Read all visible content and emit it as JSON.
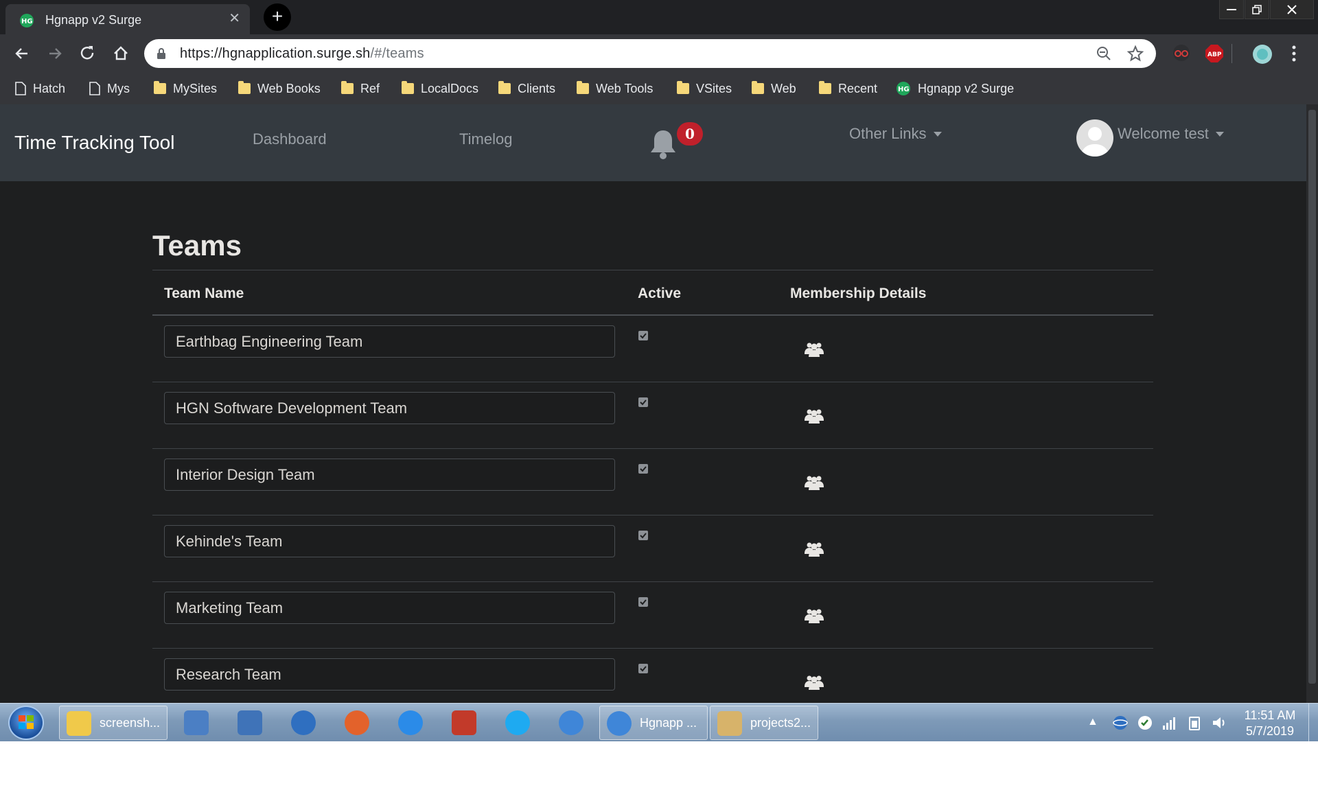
{
  "browser": {
    "tab_title": "Hgnapp v2 Surge",
    "tab_close": "✕",
    "new_tab": "+",
    "url_host": "https://hgnapplication.surge.sh",
    "url_path": "/#/teams",
    "ext_abp": "ABP",
    "bookmarks": [
      {
        "label": "Hatch",
        "icon": "page"
      },
      {
        "label": "Mys",
        "icon": "page"
      },
      {
        "label": "MySites",
        "icon": "folder"
      },
      {
        "label": "Web Books",
        "icon": "folder"
      },
      {
        "label": "Ref",
        "icon": "folder"
      },
      {
        "label": "LocalDocs",
        "icon": "folder"
      },
      {
        "label": "Clients",
        "icon": "folder"
      },
      {
        "label": "Web Tools",
        "icon": "folder"
      },
      {
        "label": "VSites",
        "icon": "folder"
      },
      {
        "label": "Web",
        "icon": "folder"
      },
      {
        "label": "Recent",
        "icon": "folder"
      },
      {
        "label": "Hgnapp v2 Surge",
        "icon": "hgn-favicon"
      }
    ]
  },
  "app": {
    "brand": "Time Tracking Tool",
    "nav": {
      "dashboard": "Dashboard",
      "timelog": "Timelog",
      "notification_count": "0",
      "other_links": "Other Links",
      "welcome": "Welcome test"
    },
    "page": {
      "title": "Teams",
      "columns": {
        "team_name": "Team Name",
        "active": "Active",
        "membership": "Membership Details"
      },
      "teams": [
        {
          "name": "Earthbag Engineering Team",
          "active": true
        },
        {
          "name": "HGN Software Development Team",
          "active": true
        },
        {
          "name": "Interior Design Team",
          "active": true
        },
        {
          "name": "Kehinde's Team",
          "active": true
        },
        {
          "name": "Marketing Team",
          "active": true
        },
        {
          "name": "Research Team",
          "active": true
        }
      ]
    }
  },
  "taskbar": {
    "items": [
      {
        "label": "screensh...",
        "icon": "folder-icon",
        "button": true
      },
      {
        "label": "",
        "icon": "computer-icon",
        "button": false
      },
      {
        "label": "",
        "icon": "search-computer-icon",
        "button": false
      },
      {
        "label": "",
        "icon": "thunderbird-icon",
        "button": false
      },
      {
        "label": "",
        "icon": "firefox-icon",
        "button": false
      },
      {
        "label": "",
        "icon": "internet-explorer-icon",
        "button": false
      },
      {
        "label": "",
        "icon": "filezilla-icon",
        "button": false
      },
      {
        "label": "",
        "icon": "skype-icon",
        "button": false
      },
      {
        "label": "",
        "icon": "chrome-user-icon",
        "button": false
      },
      {
        "label": "Hgnapp ...",
        "icon": "chrome-icon",
        "button": true
      },
      {
        "label": "projects2...",
        "icon": "paint-icon",
        "button": true
      }
    ],
    "time": "11:51 AM",
    "date": "5/7/2019"
  }
}
